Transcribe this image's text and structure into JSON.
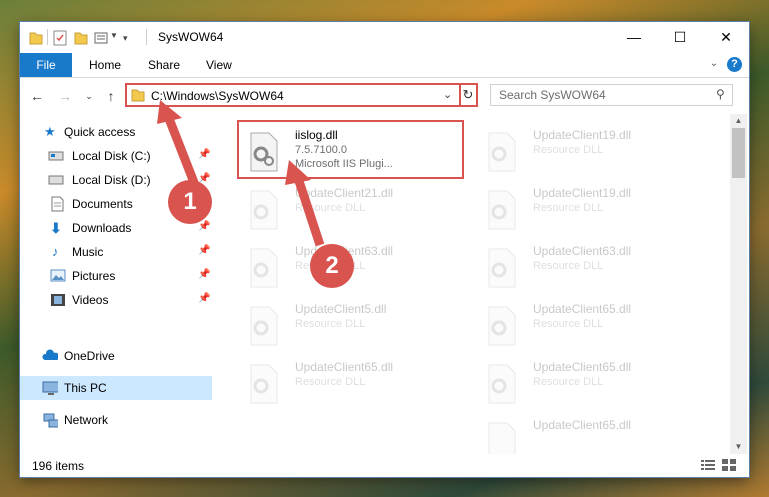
{
  "window": {
    "title": "SysWOW64",
    "controls": {
      "minimize": "—",
      "maximize": "☐",
      "close": "✕"
    }
  },
  "ribbon": {
    "tabs": [
      "File",
      "Home",
      "Share",
      "View"
    ],
    "help_label": "?"
  },
  "address_bar": {
    "path": "C:\\Windows\\SysWOW64",
    "search_placeholder": "Search SysWOW64"
  },
  "nav_pane": {
    "items": [
      {
        "label": "Quick access",
        "icon": "star-icon"
      },
      {
        "label": "Local Disk (C:)",
        "icon": "drive-icon",
        "pinned": true
      },
      {
        "label": "Local Disk (D:)",
        "icon": "drive-icon",
        "pinned": true
      },
      {
        "label": "Documents",
        "icon": "documents-icon",
        "pinned": true
      },
      {
        "label": "Downloads",
        "icon": "download-icon",
        "pinned": true
      },
      {
        "label": "Music",
        "icon": "music-icon",
        "pinned": true
      },
      {
        "label": "Pictures",
        "icon": "pictures-icon",
        "pinned": true
      },
      {
        "label": "Videos",
        "icon": "videos-icon",
        "pinned": true
      },
      {
        "label": "OneDrive",
        "icon": "onedrive-icon"
      },
      {
        "label": "This PC",
        "icon": "computer-icon",
        "selected": true
      },
      {
        "label": "Network",
        "icon": "network-icon"
      }
    ]
  },
  "files": {
    "featured": {
      "name": "iislog.dll",
      "version": "7.5.7100.0",
      "description": "Microsoft IIS Plugi..."
    },
    "background": [
      {
        "name": "UpdateClient19.dll",
        "type": "Resource DLL"
      },
      {
        "name": "UpdateClient21.dll",
        "type": "Resource DLL"
      },
      {
        "name": "UpdateClient19.dll",
        "type": "Resource DLL"
      },
      {
        "name": "UpdateClient63.dll",
        "type": "Resource DLL"
      },
      {
        "name": "UpdateClient63.dll",
        "type": "Resource DLL"
      },
      {
        "name": "UpdateClient5.dll",
        "type": "Resource DLL"
      },
      {
        "name": "UpdateClient65.dll",
        "type": "Resource DLL"
      },
      {
        "name": "UpdateClient65.dll",
        "type": "Resource DLL"
      },
      {
        "name": "UpdateClient65.dll",
        "type": "Resource DLL"
      },
      {
        "name": "UpdateClient65.dll",
        "type": "Resource DLL"
      }
    ]
  },
  "status": {
    "item_count": "196 items"
  },
  "annotations": {
    "step1": "1",
    "step2": "2"
  },
  "colors": {
    "accent": "#1979ca",
    "highlight": "#d9534f",
    "selection": "#cce8ff"
  }
}
